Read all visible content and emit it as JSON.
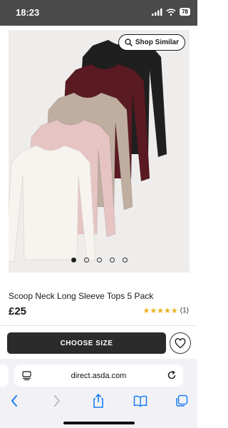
{
  "status_bar": {
    "time": "18:23",
    "battery": "78"
  },
  "gallery": {
    "shop_similar_label": "Shop Similar",
    "slide_count": 5,
    "active_slide": 1,
    "top_colors": [
      "#1f1f1f",
      "#5a1a22",
      "#bfaea0",
      "#e6c4c4",
      "#f7f4ef"
    ]
  },
  "product": {
    "title": "Scoop Neck Long Sleeve Tops 5 Pack",
    "price": "£25",
    "rating": 5,
    "review_count": "(1)"
  },
  "actions": {
    "choose_size_label": "CHOOSE SIZE"
  },
  "browser": {
    "url": "direct.asda.com"
  },
  "colors": {
    "star": "#e8b21f",
    "ios_blue": "#1a7cf5",
    "button_dark": "#2b2b2b"
  }
}
